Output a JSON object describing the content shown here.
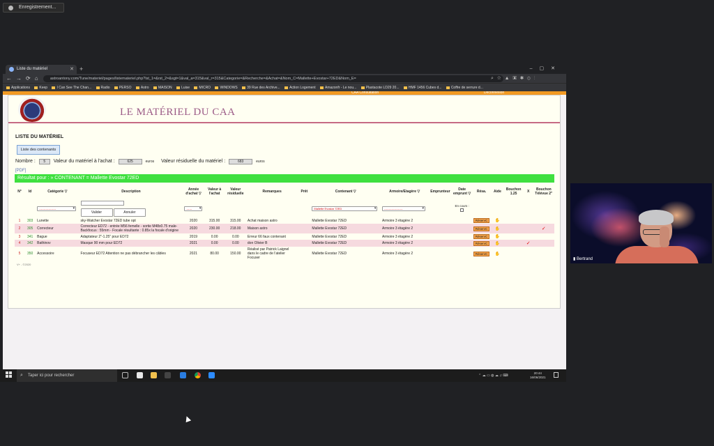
{
  "recording": {
    "label": "Enregistrement..."
  },
  "browser": {
    "tab_title": "Liste du matériel",
    "url": "astroantony.com/Tune/materiel/pages/listemateriel.php?lst_1=&rst_2=&sgt=1&val_a=315&val_r=315&Categorie=&Recherche=&Achat=&Nom_C=Mallette+Evostar+72ED&Nom_E=",
    "bookmarks": [
      "Applications",
      "Keep",
      "I Can See The Chan...",
      "Radio",
      "PERSO",
      "Astro",
      "MAISON",
      "Luise",
      "MICRO",
      "WINDOWS",
      "39 Rue des Archive...",
      "Action Logement",
      "Amazonfr - Le nou...",
      "Plastacote LD29 20...",
      "HMF 1456 Cubes d...",
      "Coffre de serrure d..."
    ]
  },
  "site": {
    "top_links": [
      "CAA Consultation",
      "Déconnexion"
    ],
    "title": "LE MATÉRIEL DU CAA",
    "section_title": "LISTE DU MATÉRIEL",
    "list_button": "Liste des contenants",
    "stats": {
      "nombre_label": "Nombre :",
      "nombre_value": "5",
      "achat_label": "Valeur du matériel à l'achat :",
      "achat_value": "625",
      "achat_unit": "euros",
      "resid_label": "Valeur résiduelle du matériel :",
      "resid_value": "683",
      "resid_unit": "euros"
    },
    "pdf_link": "[PDF]",
    "result_banner": "Résultat pour : » CONTENANT = Mallette Evostar 72ED",
    "filters": {
      "categorie": "------------------",
      "annee": "------",
      "contenant": "Mallette Evostar 72ED",
      "armoire": "--------------------",
      "valider": "Valider",
      "annuler": "Annuler",
      "en_cours": "En cours :"
    },
    "columns": [
      "N°",
      "Id",
      "Catégorie ▽",
      "Description",
      "Année d'achat ▽",
      "Valeur à l'achat",
      "Valeur résiduelle",
      "Remarques",
      "Prêt",
      "Contenant ▽",
      "Armoire/Etagère ▽",
      "Emprunteur",
      "Date emprunt ▽",
      "Résa.",
      "Aide",
      "Bouchon 1.25",
      "X",
      "Bouchon Télévue 2\""
    ],
    "rows": [
      {
        "n": "1",
        "id": "303",
        "categorie": "Lunette",
        "description": "sky-Watcher Evostar 72ED tube opt",
        "annee": "2020",
        "achat": "315.00",
        "residuelle": "315.00",
        "remarques": "Achat maison astro",
        "contenant": "Mallette Evostar 72ED",
        "armoire": "Armoire 3 étagère 2",
        "resa": "RéservC",
        "x": "",
        "televue": ""
      },
      {
        "n": "2",
        "id": "305",
        "categorie": "Correcteur",
        "description": "Correcteur ED72 - entrée M56 femelle - sortie M48x0.75 male- Backfocus : 55mm - Focale résultante : 0.85x la focale d'origine",
        "annee": "2020",
        "achat": "230.00",
        "residuelle": "218.00",
        "remarques": "Maison astro",
        "contenant": "Mallette Evostar 72ED",
        "armoire": "Armoire 3 étagère 2",
        "resa": "RéservC",
        "x": "",
        "televue": "✓"
      },
      {
        "n": "3",
        "id": "341",
        "categorie": "Bague",
        "description": "Adaptateur 2\"-1.25\" pour ED72",
        "annee": "2019",
        "achat": "0.00",
        "residuelle": "0.00",
        "remarques": "Erreur 66 faux contenant",
        "contenant": "Mallette Evostar 72ED",
        "armoire": "Armoire 3 étagère 2",
        "resa": "RéservC",
        "x": "",
        "televue": ""
      },
      {
        "n": "4",
        "id": "342",
        "categorie": "Bathinov",
        "description": "Masque 90 mm pour ED72",
        "annee": "2021",
        "achat": "0.00",
        "residuelle": "0.00",
        "remarques": "don Olivier B",
        "contenant": "Mallette Evostar 72ED",
        "armoire": "Armoire 3 étagère 2",
        "resa": "RéservC",
        "x": "✓",
        "televue": ""
      },
      {
        "n": "5",
        "id": "350",
        "categorie": "Accessoire",
        "description": "Focuseur ED72 Attention ne pas débrancher les câbles",
        "annee": "2021",
        "achat": "80.00",
        "residuelle": "150.00",
        "remarques": "Réalisé par Patrick Laignel dans le cadre de l'atelier Focuser",
        "contenant": "Mallette Evostar 72ED",
        "armoire": "Armoire 3 étagère 2",
        "resa": "RéservC",
        "x": "",
        "televue": ""
      }
    ],
    "footer_note": "V+ - ©2020"
  },
  "taskbar": {
    "search_placeholder": "Taper ici pour rechercher",
    "time": "20:44",
    "date": "16/06/2021"
  },
  "webcam": {
    "name": "Bertrand"
  }
}
